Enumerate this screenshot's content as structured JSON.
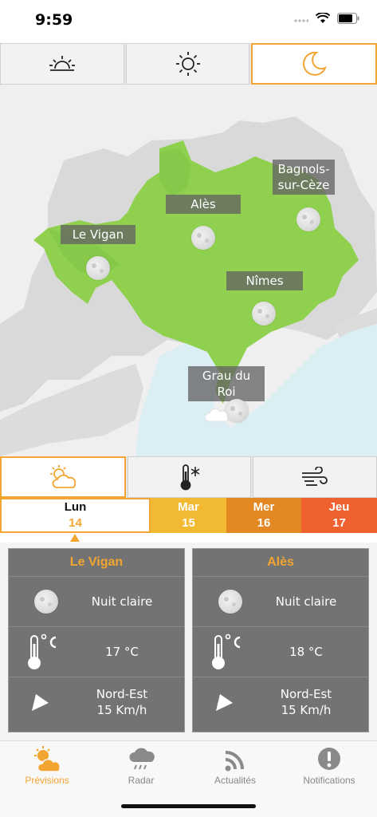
{
  "status_bar": {
    "time": "9:59"
  },
  "period_tabs": [
    {
      "icon": "sunrise-icon"
    },
    {
      "icon": "sun-icon"
    },
    {
      "icon": "moon-icon",
      "active": true
    }
  ],
  "map": {
    "cities": [
      {
        "name": "Le Vigan",
        "weather_icon": "clear-night-icon"
      },
      {
        "name": "Alès",
        "weather_icon": "clear-night-icon"
      },
      {
        "name": "Bagnols-sur-Cèze",
        "line1": "Bagnols-",
        "line2": "sur-Cèze",
        "weather_icon": "clear-night-icon"
      },
      {
        "name": "Nîmes",
        "weather_icon": "clear-night-icon"
      },
      {
        "name": "Grau du Roi",
        "weather_icon": "cloudy-night-icon"
      }
    ],
    "colors": {
      "region": "#8fd14f",
      "land": "#d9d9d9",
      "sea": "#dbeef4",
      "background": "#efefef"
    }
  },
  "forecast_tabs": [
    {
      "icon": "partly-cloudy-icon",
      "active": true
    },
    {
      "icon": "thermometer-snow-icon"
    },
    {
      "icon": "wind-icon"
    }
  ],
  "days": [
    {
      "name": "Lun",
      "number": "14",
      "selected": true
    },
    {
      "name": "Mar",
      "number": "15"
    },
    {
      "name": "Mer",
      "number": "16"
    },
    {
      "name": "Jeu",
      "number": "17"
    }
  ],
  "cards": [
    {
      "city": "Le Vigan",
      "weather": "Nuit claire",
      "temperature": "17 °C",
      "wind_direction": "Nord-Est",
      "wind_speed": "15 Km/h"
    },
    {
      "city": "Alès",
      "weather": "Nuit claire",
      "temperature": "18 °C",
      "wind_direction": "Nord-Est",
      "wind_speed": "15 Km/h"
    }
  ],
  "nav": [
    {
      "label": "Prévisions",
      "icon": "sun-cloud-icon",
      "active": true
    },
    {
      "label": "Radar",
      "icon": "rain-cloud-icon"
    },
    {
      "label": "Actualités",
      "icon": "rss-icon"
    },
    {
      "label": "Notifications",
      "icon": "exclamation-icon"
    }
  ],
  "colors": {
    "accent": "#f2a531",
    "card_bg": "#737373",
    "day2": "#f2ba32",
    "day3": "#e38722",
    "day4": "#f06130"
  }
}
